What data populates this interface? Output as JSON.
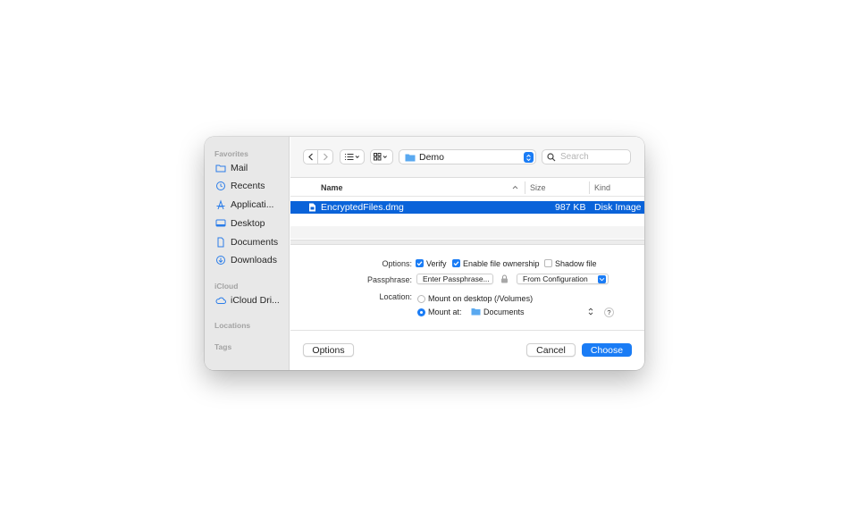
{
  "sidebar": {
    "favorites_header": "Favorites",
    "items": [
      {
        "label": "Mail",
        "icon": "folder-icon"
      },
      {
        "label": "Recents",
        "icon": "clock-icon"
      },
      {
        "label": "Applicati...",
        "icon": "applications-icon"
      },
      {
        "label": "Desktop",
        "icon": "desktop-icon"
      },
      {
        "label": "Documents",
        "icon": "document-icon"
      },
      {
        "label": "Downloads",
        "icon": "download-icon"
      }
    ],
    "icloud_header": "iCloud",
    "icloud_item": {
      "label": "iCloud Dri...",
      "icon": "cloud-icon"
    },
    "locations_header": "Locations",
    "tags_header": "Tags"
  },
  "toolbar": {
    "path": "Demo",
    "search_placeholder": "Search"
  },
  "columns": {
    "name": "Name",
    "size": "Size",
    "kind": "Kind"
  },
  "files": [
    {
      "name": "EncryptedFiles.dmg",
      "size": "987 KB",
      "kind": "Disk Image",
      "selected": true
    }
  ],
  "options": {
    "options_label": "Options:",
    "verify": "Verify",
    "enable_ownership": "Enable file ownership",
    "shadow_file": "Shadow file",
    "passphrase_label": "Passphrase:",
    "passphrase_button": "Enter Passphrase...",
    "passphrase_source": "From Configuration",
    "location_label": "Location:",
    "mount_desktop": "Mount on desktop (/Volumes)",
    "mount_at": "Mount at:",
    "mount_folder": "Documents",
    "help": "?"
  },
  "footer": {
    "options": "Options",
    "cancel": "Cancel",
    "choose": "Choose"
  },
  "colors": {
    "accent": "#1a7cf5",
    "selection": "#0a63d9"
  }
}
